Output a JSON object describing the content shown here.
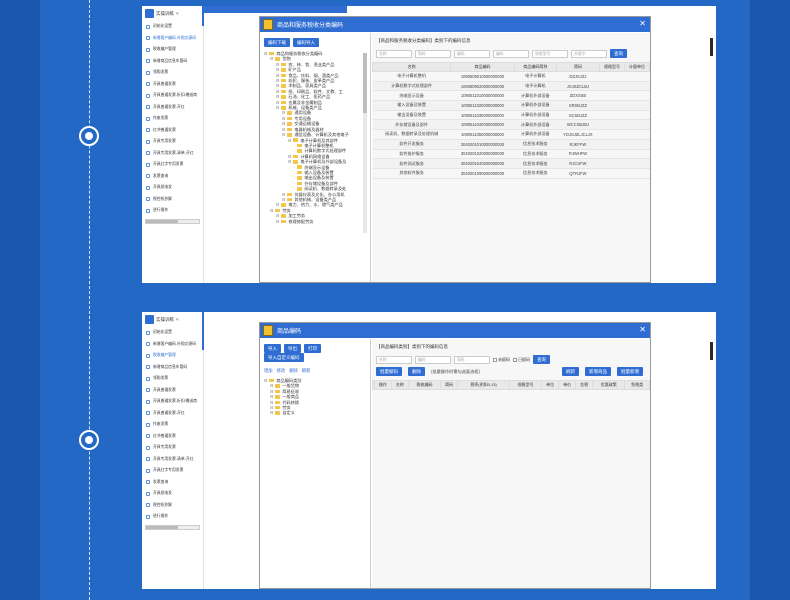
{
  "panel1": {
    "sidebar": {
      "app_title": "实操训练",
      "items": [
        "初始化设置",
        "新增客户编码-外购文源码",
        "税收编户管理",
        "新增商品信息车管码",
        "领购发票",
        "开具普通发票",
        "开具普通发票-折扣/赠送商",
        "开具普通发票-开红",
        "作废发票",
        "红冲普通发票",
        "开具专用发票",
        "开具专用发票-清单-开红",
        "开具红字专用发票",
        "发票查询",
        "开具纸电发",
        "税控机抄解",
        "进行操作"
      ]
    },
    "dialog": {
      "title": "商品和服务税收分类编码",
      "buttons": [
        "编码下载",
        "编码导入"
      ],
      "tree": [
        {
          "t": "商品和服务税收分类编码",
          "l": 0
        },
        {
          "t": "货物",
          "l": 1
        },
        {
          "t": "农、林、牧、渔业类产品",
          "l": 2
        },
        {
          "t": "矿产品",
          "l": 2
        },
        {
          "t": "食品、饮料、烟、酒类产品",
          "l": 2
        },
        {
          "t": "纺织、服装、皮革类产品",
          "l": 2
        },
        {
          "t": "木制品、家具类产品",
          "l": 2
        },
        {
          "t": "纸、印刷品、软件、文教、工",
          "l": 2
        },
        {
          "t": "石油、化工、医药产品",
          "l": 2
        },
        {
          "t": "金属及非金属制品",
          "l": 2
        },
        {
          "t": "机械、设备类产品",
          "l": 2
        },
        {
          "t": "通用设备",
          "l": 3
        },
        {
          "t": "专用设备",
          "l": 3
        },
        {
          "t": "交通运输设备",
          "l": 3
        },
        {
          "t": "电器机械及器材",
          "l": 3
        },
        {
          "t": "通信设备、计算机及其他电子",
          "l": 3
        },
        {
          "t": "电子计算机及其部件",
          "l": 4
        },
        {
          "t": "电子计算机整机",
          "l": 5
        },
        {
          "t": "计算机数字式处理部件",
          "l": 5
        },
        {
          "t": "计算机网络设备",
          "l": 4
        },
        {
          "t": "电子计算机及外部设备及",
          "l": 4
        },
        {
          "t": "终端显示设备",
          "l": 5
        },
        {
          "t": "输入设备及装置",
          "l": 5
        },
        {
          "t": "输出设备及装置",
          "l": 5
        },
        {
          "t": "外存储设备及部件",
          "l": 5
        },
        {
          "t": "阅读机、数据转录及处",
          "l": 5
        },
        {
          "t": "仪器仪表及文化、办公用机",
          "l": 3
        },
        {
          "t": "其他机械、设备类产品",
          "l": 3
        },
        {
          "t": "电力、热力、水、燃气类产品",
          "l": 2
        },
        {
          "t": "劳务",
          "l": 1
        },
        {
          "t": "加工劳务",
          "l": 2
        },
        {
          "t": "修理修配劳务",
          "l": 2
        }
      ],
      "right_title": "【商品和服务税收分类编码】类别下的编码信息",
      "filters": [
        "名称",
        "简码",
        "编码",
        "编码",
        "规格型号",
        "关键字"
      ],
      "query": "查询",
      "headers": [
        "名称",
        "商品编码",
        "商品编码简称",
        "简码",
        "规格型号",
        "计量单位"
      ],
      "rows": [
        [
          "电子计算机整机",
          "1090509010000000000",
          "电子计算机",
          "DZJSJZJ",
          "",
          ""
        ],
        [
          "计算机数字式处理部件",
          "1090509020000000000",
          "电子计算机",
          "JSJSZCLBJ",
          "",
          ""
        ],
        [
          "终端显示设备",
          "1090511010000000000",
          "计算机外部设备",
          "ZDXSSB",
          "",
          ""
        ],
        [
          "输入设备及装置",
          "1090511020000000000",
          "计算机外部设备",
          "SRSBJZZ",
          "",
          ""
        ],
        [
          "输出设备及装置",
          "1090511030000000000",
          "计算机外部设备",
          "SCSBJZZ",
          "",
          ""
        ],
        [
          "外存储设备及部件",
          "1090511040000000000",
          "计算机外部设备",
          "WCCSBJBJ",
          "",
          ""
        ],
        [
          "阅读机、数据转录及处理机械",
          "1090511050000000000",
          "计算机外部设备",
          "YDJSJZLJCLJX",
          "",
          ""
        ],
        [
          "软件开发服务",
          "3040201010000000000",
          "信息技术服务",
          "RJKFFW",
          "",
          ""
        ],
        [
          "软件维护服务",
          "3040201020000000000",
          "信息技术服务",
          "RJWHFW",
          "",
          ""
        ],
        [
          "软件测试服务",
          "3040201040000000000",
          "信息技术服务",
          "RJCSFW",
          "",
          ""
        ],
        [
          "其他软件服务",
          "3040201090000000000",
          "信息技术服务",
          "QTRJFW",
          "",
          ""
        ]
      ]
    }
  },
  "panel2": {
    "sidebar": {
      "app_title": "实操训练",
      "items": [
        "初始化设置",
        "新增客户编码-外购文源码",
        "税收编户管理",
        "新增商品信息车管码",
        "领购发票",
        "开具普通发票",
        "开具普通发票-折扣/赠送商",
        "开具普通发票-开红",
        "作废发票",
        "红冲普通发票",
        "开具专用发票",
        "开具专用发票-清单-开红",
        "开具红字专用发票",
        "发票查询",
        "开具纸电发",
        "税控机抄解",
        "进行操作"
      ]
    },
    "dialog": {
      "title": "商品编码",
      "buttons": [
        "导入",
        "导出",
        "打印",
        "导入自定义编码"
      ],
      "links": [
        "增加",
        "修改",
        "删除",
        "刷新"
      ],
      "tree": [
        {
          "t": "商品编码类别",
          "l": 0
        },
        {
          "t": "一般货物",
          "l": 1
        },
        {
          "t": "简易征收",
          "l": 1
        },
        {
          "t": "一般商品",
          "l": 1
        },
        {
          "t": "代码转换",
          "l": 1
        },
        {
          "t": "劳务",
          "l": 1
        },
        {
          "t": "自定义",
          "l": 1
        }
      ],
      "right_title": "【商品编码类别】类别下的编码信息",
      "filters": [
        "名称",
        "编码",
        "简码"
      ],
      "checks": [
        "未赋码",
        "已赋码"
      ],
      "query": "查询",
      "batch_buttons": [
        "批量赋码",
        "删除"
      ],
      "hint": "(批量操作时需勾选复选框)",
      "action_buttons": [
        "刷新",
        "新增商品",
        "批量新增"
      ],
      "headers": [
        "",
        "操作",
        "名称",
        "税收编码",
        "简码",
        "税率(例如0.13)",
        "规格型号",
        "单位",
        "单价",
        "含税",
        "优惠政策",
        "免税类"
      ]
    }
  }
}
